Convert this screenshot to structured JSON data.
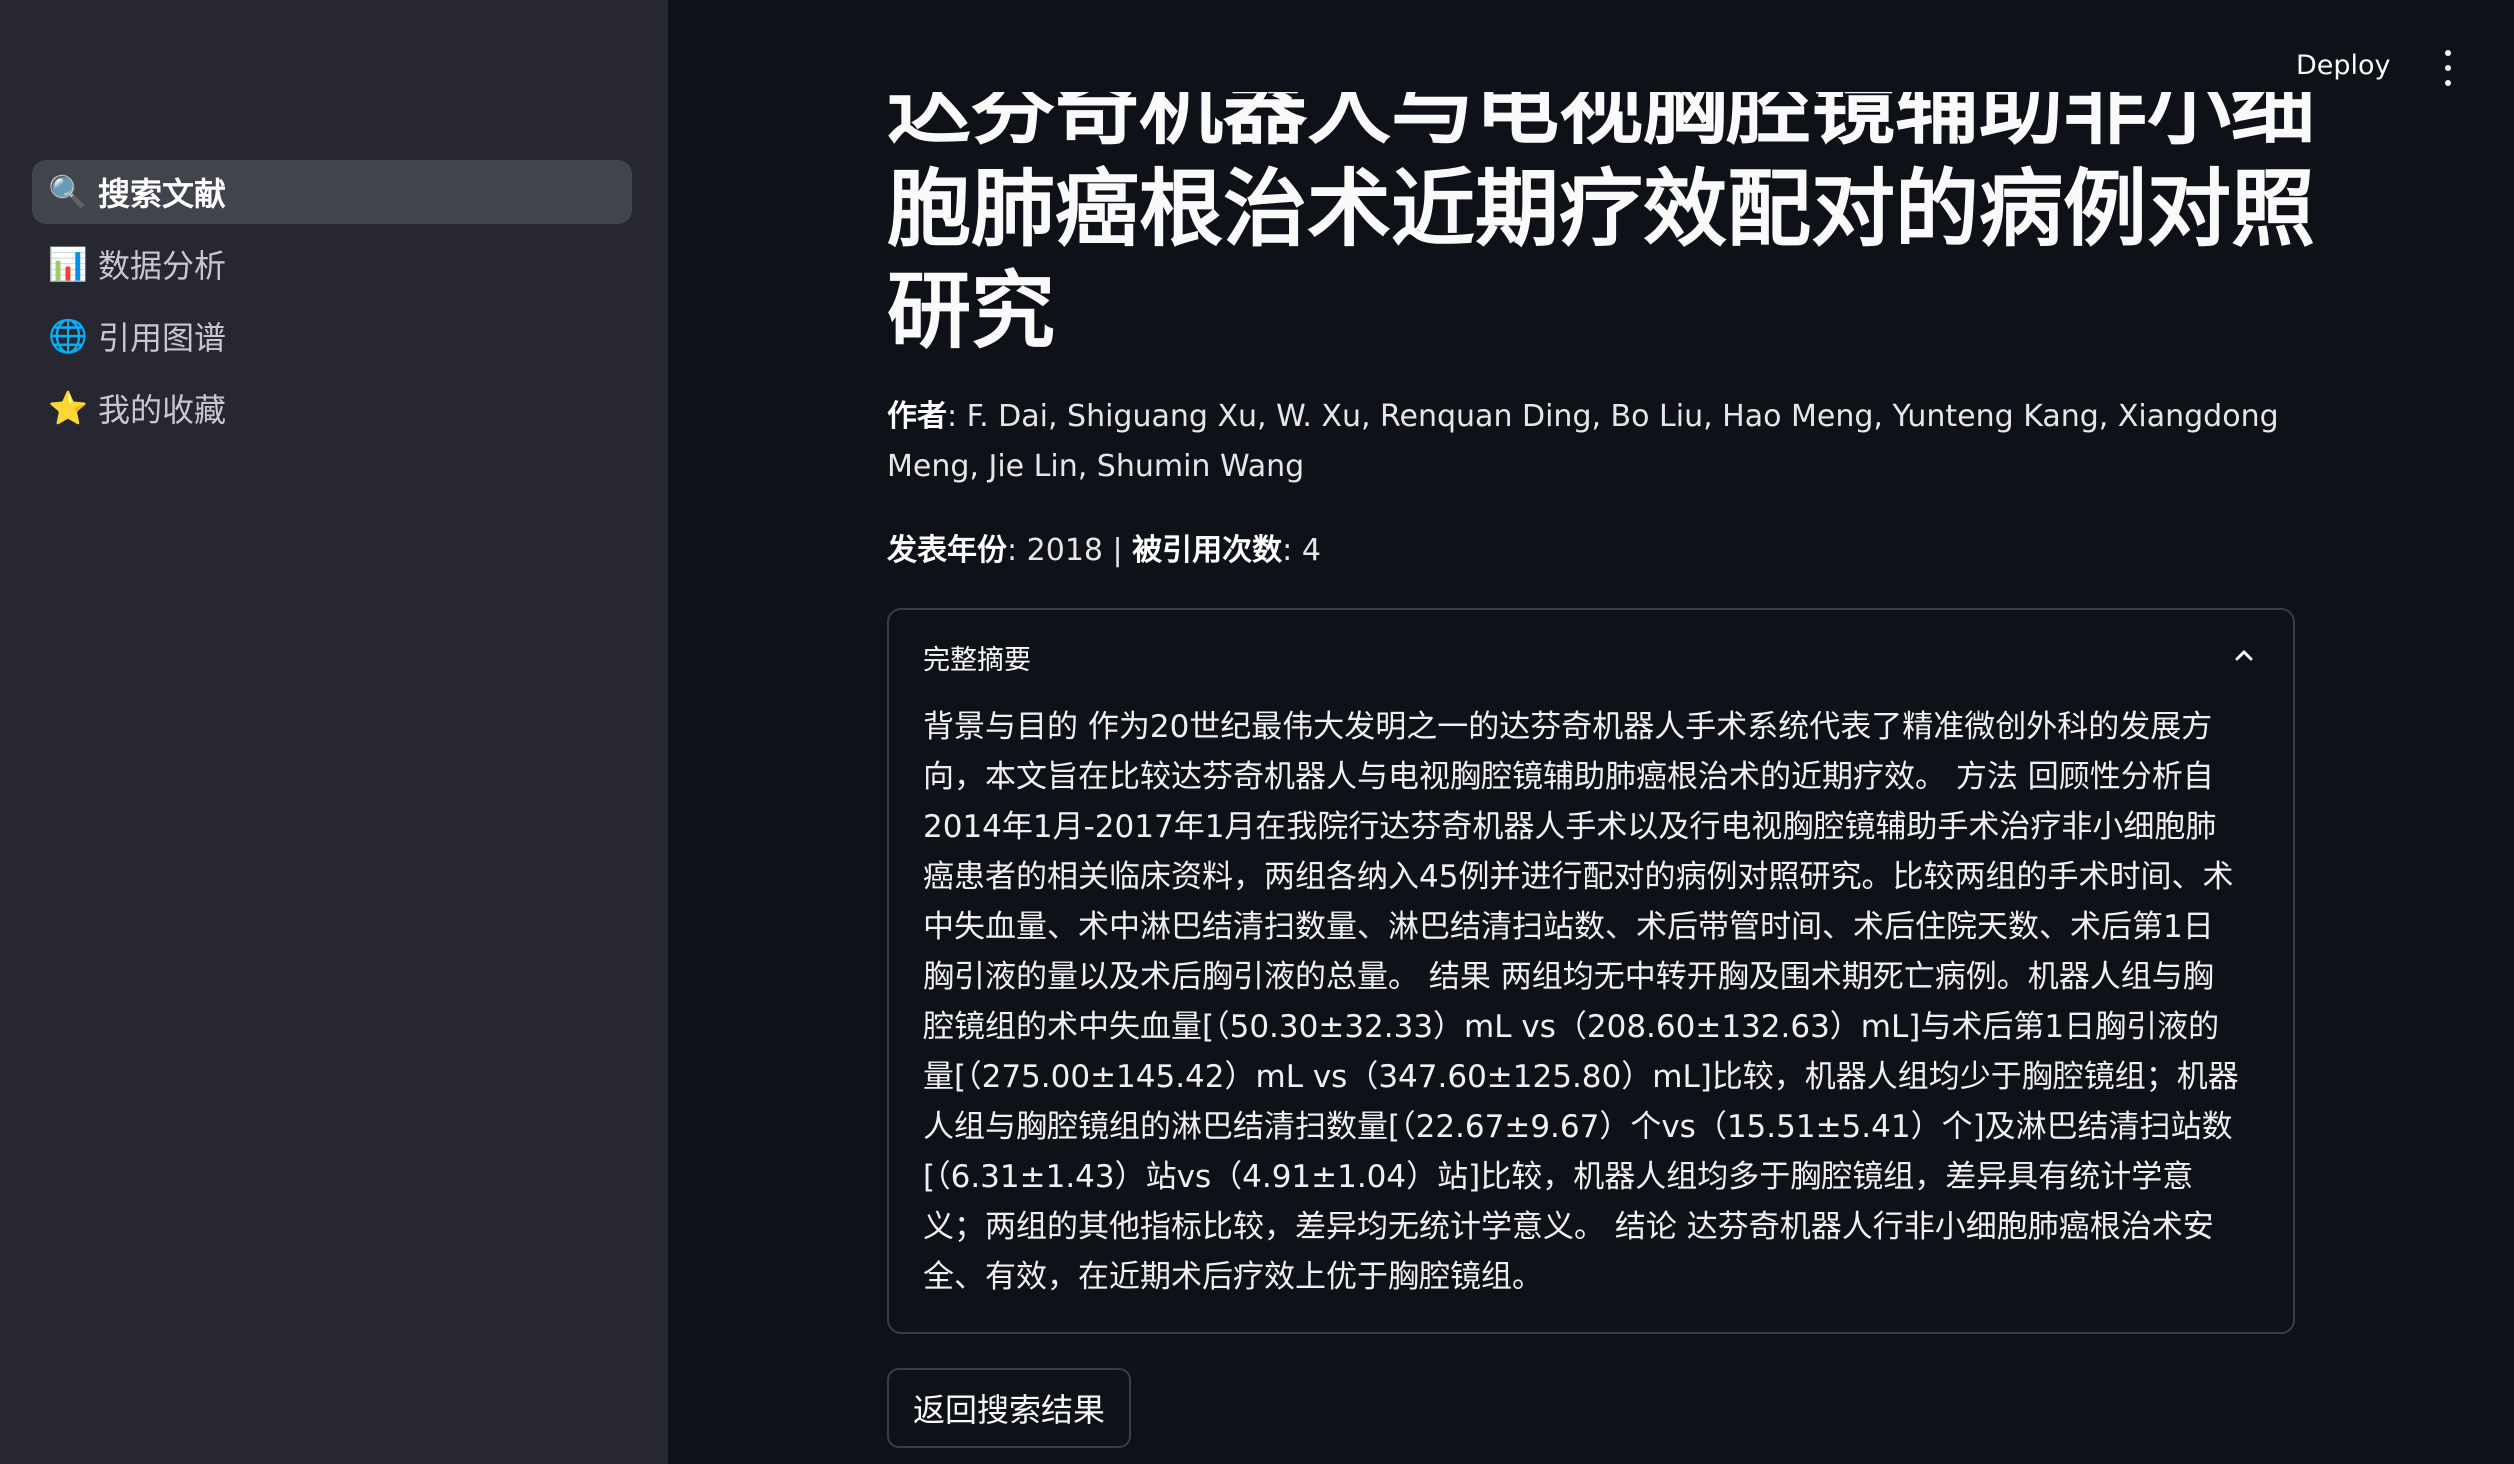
{
  "header": {
    "deploy_label": "Deploy"
  },
  "sidebar": {
    "items": [
      {
        "icon": "🔍",
        "icon_name": "search-icon",
        "label": "搜索文献",
        "active": true
      },
      {
        "icon": "📊",
        "icon_name": "bar-chart-icon",
        "label": "数据分析",
        "active": false
      },
      {
        "icon": "🌐",
        "icon_name": "globe-icon",
        "label": "引用图谱",
        "active": false
      },
      {
        "icon": "⭐",
        "icon_name": "star-icon",
        "label": "我的收藏",
        "active": false
      }
    ]
  },
  "paper": {
    "title": "达芬奇机器人与电视胸腔镜辅助非小细胞肺癌根治术近期疗效配对的病例对照研究",
    "authors_label": "作者",
    "authors": ": F. Dai, Shiguang Xu, W. Xu, Renquan Ding, Bo Liu, Hao Meng, Yunteng Kang, Xiangdong Meng, Jie Lin, Shumin Wang",
    "year_label": "发表年份",
    "year": ": 2018 | ",
    "citations_label": "被引用次数",
    "citations": ": 4"
  },
  "expander": {
    "header": "完整摘要",
    "abstract": "背景与目的 作为20世纪最伟大发明之一的达芬奇机器人手术系统代表了精准微创外科的发展方向，本文旨在比较达芬奇机器人与电视胸腔镜辅助肺癌根治术的近期疗效。 方法 回顾性分析自2014年1月-2017年1月在我院行达芬奇机器人手术以及行电视胸腔镜辅助手术治疗非小细胞肺癌患者的相关临床资料，两组各纳入45例并进行配对的病例对照研究。比较两组的手术时间、术中失血量、术中淋巴结清扫数量、淋巴结清扫站数、术后带管时间、术后住院天数、术后第1日胸引液的量以及术后胸引液的总量。 结果 两组均无中转开胸及围术期死亡病例。机器人组与胸腔镜组的术中失血量[（50.30±32.33）mL vs（208.60±132.63）mL]与术后第1日胸引液的量[（275.00±145.42）mL vs（347.60±125.80）mL]比较，机器人组均少于胸腔镜组；机器人组与胸腔镜组的淋巴结清扫数量[（22.67±9.67）个vs（15.51±5.41）个]及淋巴结清扫站数[（6.31±1.43）站vs（4.91±1.04）站]比较，机器人组均多于胸腔镜组，差异具有统计学意义；两组的其他指标比较，差异均无统计学意义。 结论 达芬奇机器人行非小细胞肺癌根治术安全、有效，在近期术后疗效上优于胸腔镜组。"
  },
  "actions": {
    "back_label": "返回搜索结果"
  }
}
